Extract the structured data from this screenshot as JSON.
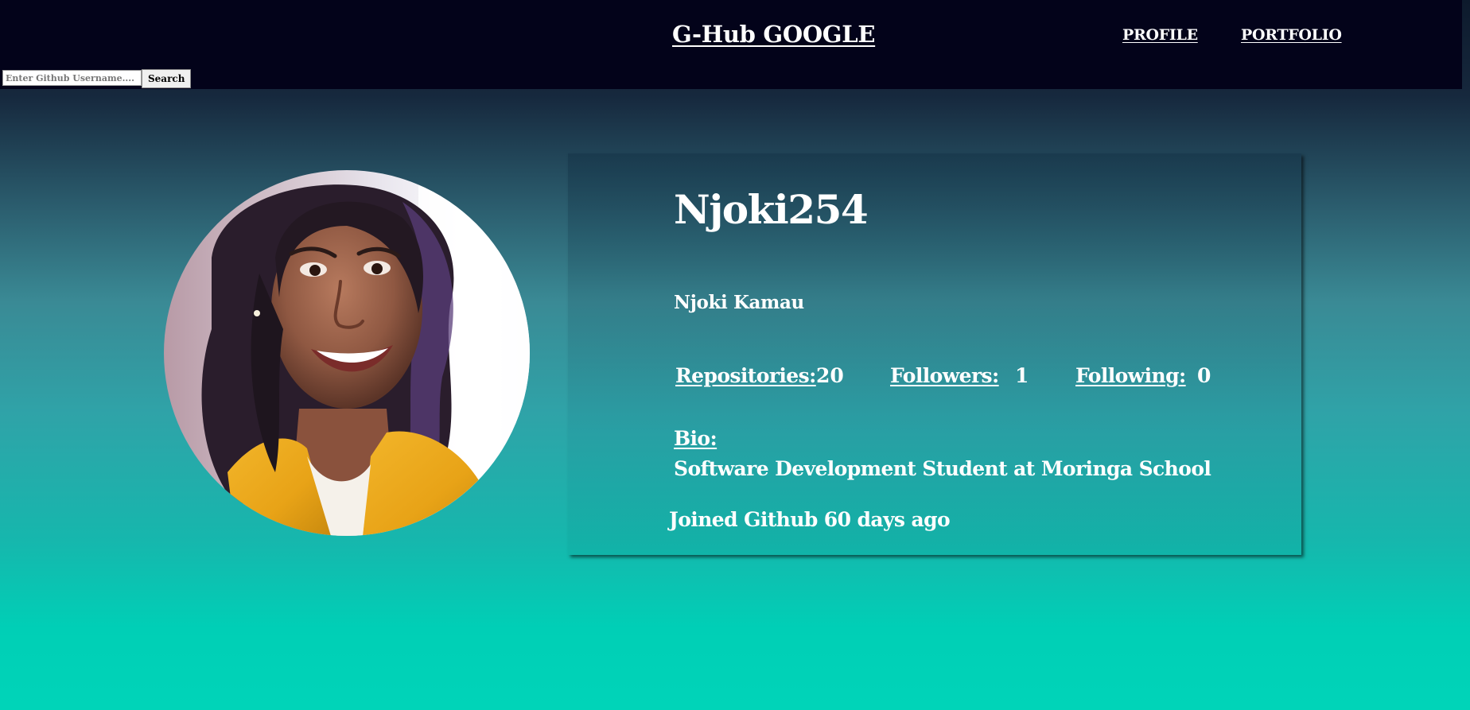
{
  "header": {
    "brand": "G-Hub GOOGLE",
    "nav": {
      "profile": "PROFILE",
      "portfolio": "PORTFOLIO"
    },
    "search": {
      "placeholder": "Enter Github Username....",
      "value": "",
      "button_label": "Search"
    }
  },
  "profile": {
    "avatar_icon": "user-avatar-photo",
    "username": "Njoki254",
    "full_name": "Njoki Kamau",
    "stats": {
      "repositories_label": "Repositories:",
      "repositories_value": "20",
      "followers_label": "Followers:",
      "followers_value": "1",
      "following_label": "Following:",
      "following_value": "0"
    },
    "bio_label": "Bio:",
    "bio": "Software Development Student at Moringa School",
    "joined": "Joined Github 60 days ago"
  },
  "colors": {
    "header_bg": "#03031a",
    "gradient_top": "#0d1a2c",
    "gradient_mid": "#3a8a95",
    "gradient_bottom": "#00d4b8",
    "text": "#ffffff"
  }
}
